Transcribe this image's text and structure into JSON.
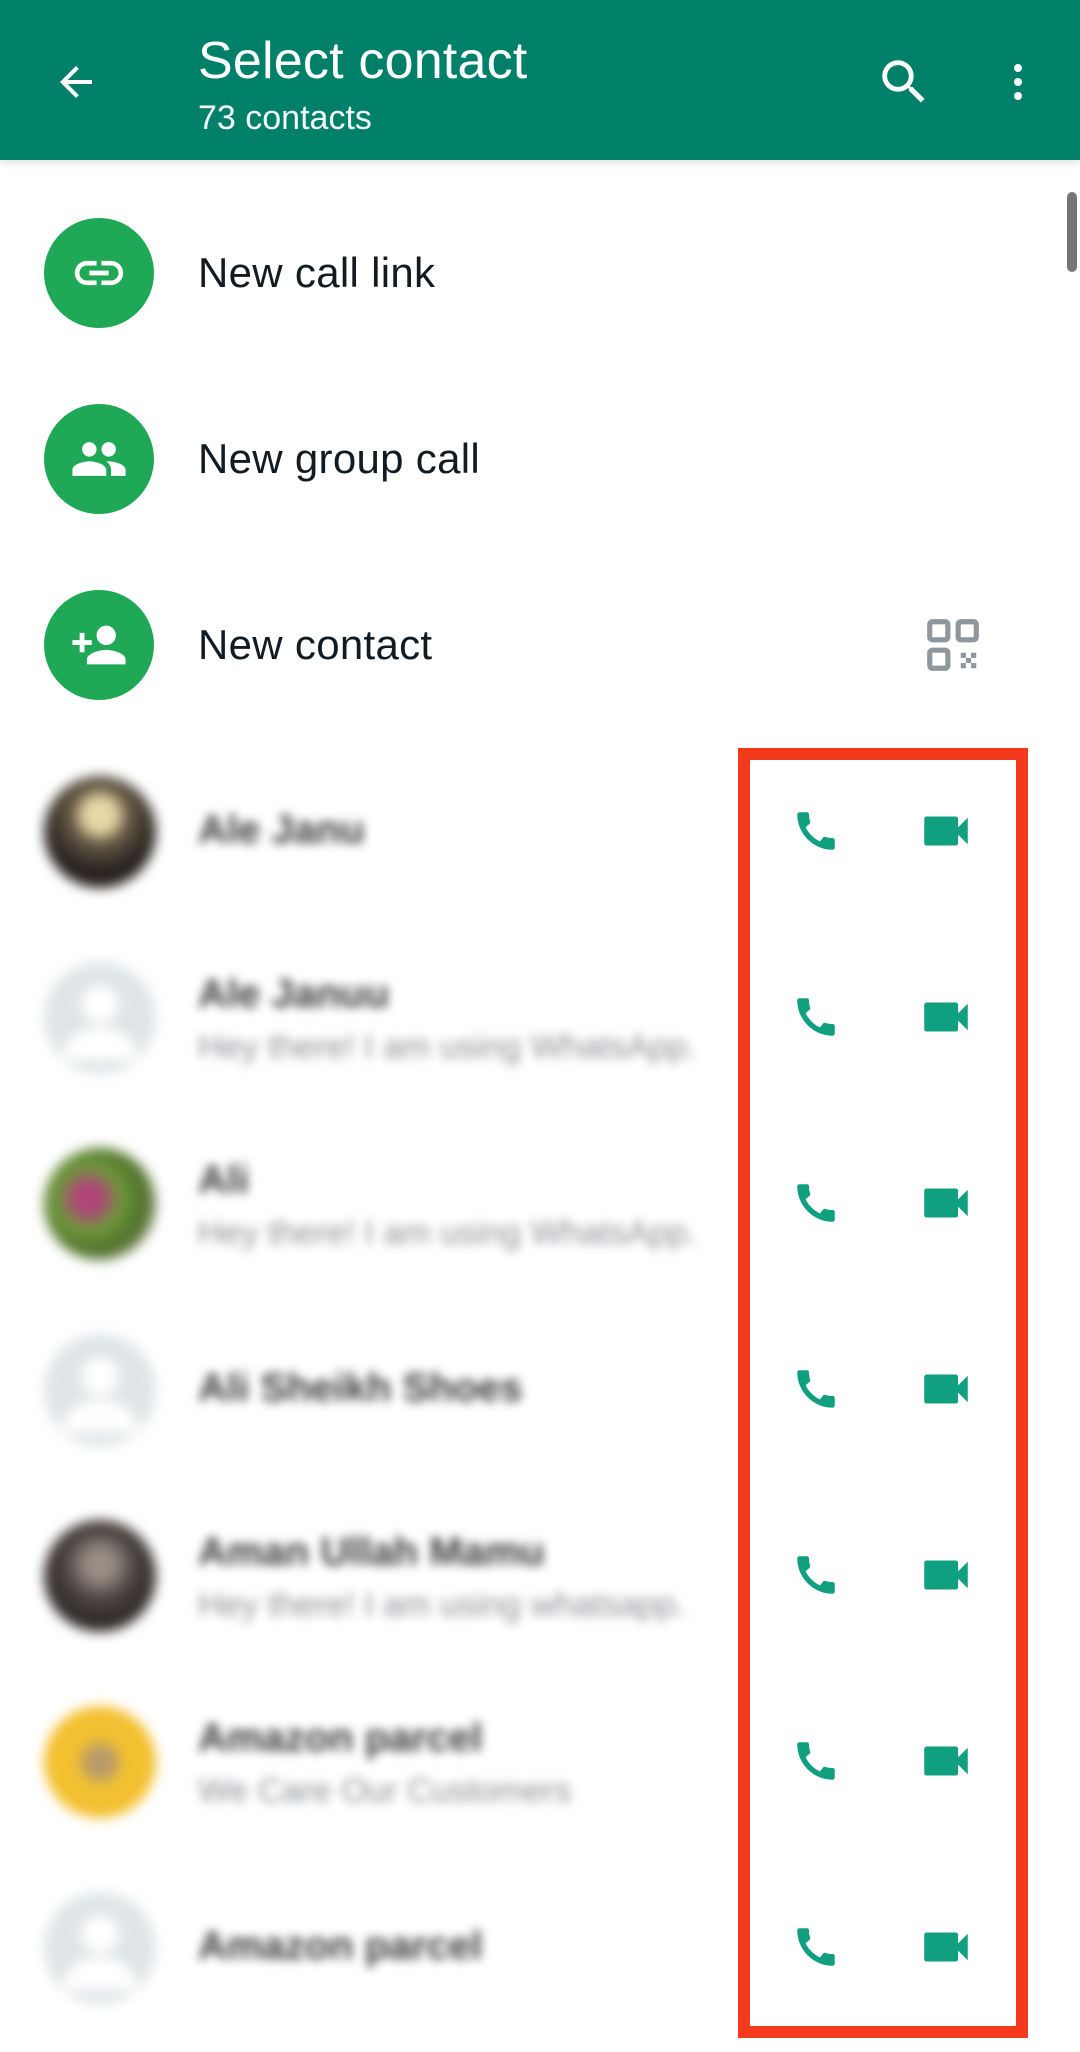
{
  "header": {
    "title": "Select contact",
    "subtitle": "73 contacts",
    "back_icon": "arrow-back-icon",
    "search_icon": "search-icon",
    "more_icon": "more-vertical-icon"
  },
  "actions": [
    {
      "label": "New call link",
      "icon": "link-icon"
    },
    {
      "label": "New group call",
      "icon": "group-icon"
    },
    {
      "label": "New contact",
      "icon": "person-add-icon",
      "trailing_icon": "qr-code-icon"
    }
  ],
  "contacts": [
    {
      "name": "Ale Janu",
      "status": ""
    },
    {
      "name": "Ale Januu",
      "status": "Hey there! I am using WhatsApp."
    },
    {
      "name": "Ali",
      "status": "Hey there! I am using WhatsApp."
    },
    {
      "name": "Ali Sheikh Shoes",
      "status": ""
    },
    {
      "name": "Aman Ullah Mamu",
      "status": "Hey there! I am using whatsapp."
    },
    {
      "name": "Amazon parcel",
      "status": "We Care Our Customers"
    },
    {
      "name": "Amazon parcel",
      "status": ""
    }
  ],
  "colors": {
    "header_bg": "#008069",
    "accent_green": "#1fa855",
    "icon_green": "#109f7f",
    "highlight_red": "#f2391b"
  }
}
